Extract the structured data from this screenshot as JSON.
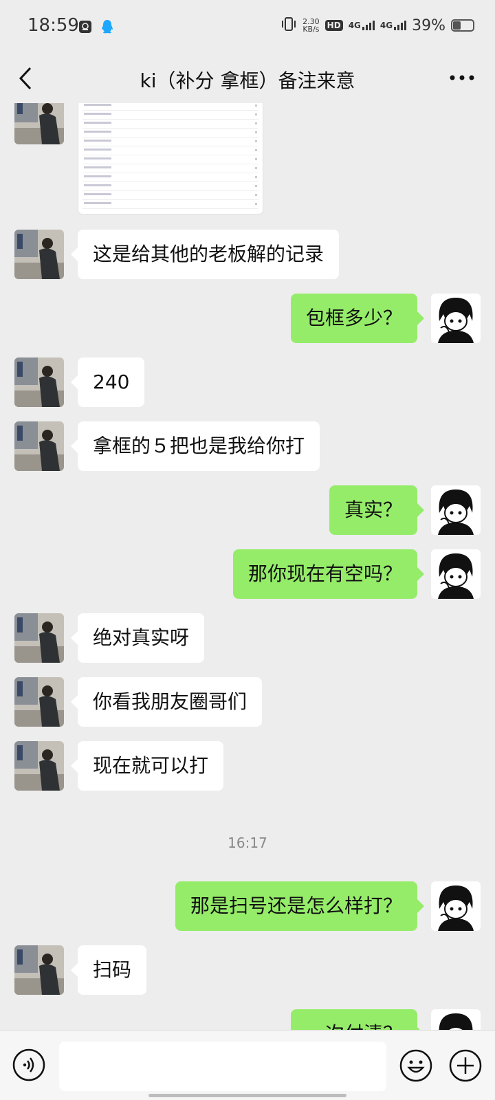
{
  "status_bar": {
    "time": "18:59",
    "net_speed_value": "2.30",
    "net_speed_unit": "KB/s",
    "hd_label": "HD",
    "sim1_label": "4G",
    "sim2_label": "4G",
    "battery_percent": "39%",
    "battery_level": 0.39
  },
  "header": {
    "title": "ki（补分  拿框）备注来意"
  },
  "chat": {
    "image_message": {
      "icon": "screenshot-thumbnail"
    },
    "messages": [
      {
        "side": "in",
        "text": "这是给其他的老板解的记录"
      },
      {
        "side": "out",
        "text": "包框多少？"
      },
      {
        "side": "in",
        "text": "240"
      },
      {
        "side": "in",
        "text": "拿框的５把也是我给你打"
      },
      {
        "side": "out",
        "text": "真实？"
      },
      {
        "side": "out",
        "text": "那你现在有空吗？"
      },
      {
        "side": "in",
        "text": "绝对真实呀"
      },
      {
        "side": "in",
        "text": "你看我朋友圈哥们"
      },
      {
        "side": "in",
        "text": "现在就可以打"
      },
      {
        "side": "out",
        "text": "那是扫号还是怎么样打？"
      },
      {
        "side": "in",
        "text": "扫码"
      },
      {
        "side": "out",
        "text": "一次付清？"
      }
    ],
    "timestamp": "16:17"
  },
  "input_bar": {
    "placeholder": "",
    "icons": [
      "voice-icon",
      "emoji-icon",
      "plus-icon"
    ]
  },
  "colors": {
    "background": "#ededed",
    "outgoing_bubble": "#95ec69",
    "incoming_bubble": "#ffffff"
  }
}
